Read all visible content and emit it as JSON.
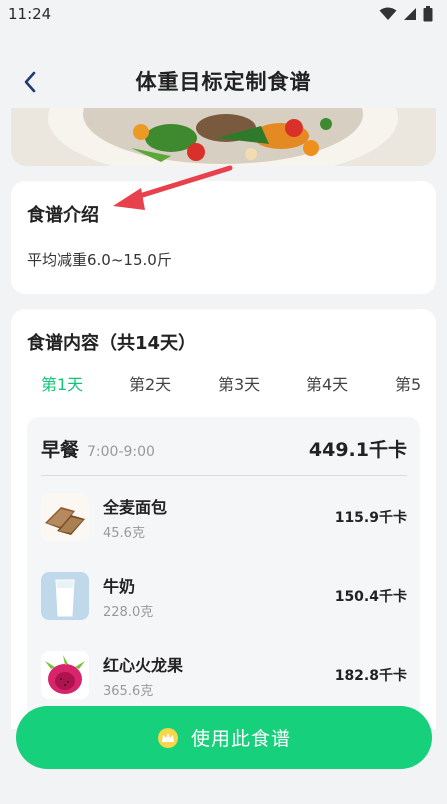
{
  "status_bar": {
    "time": "11:24"
  },
  "header": {
    "title": "体重目标定制食谱",
    "back_icon": "chevron-left-icon"
  },
  "intro": {
    "title": "食谱介绍",
    "description": "平均减重6.0~15.0斤"
  },
  "content": {
    "title": "食谱内容（共14天）",
    "tabs": [
      {
        "label": "第1天",
        "active": true
      },
      {
        "label": "第2天",
        "active": false
      },
      {
        "label": "第3天",
        "active": false
      },
      {
        "label": "第4天",
        "active": false
      },
      {
        "label": "第5",
        "active": false
      }
    ],
    "meal": {
      "name": "早餐",
      "time": "7:00-9:00",
      "kcal": "449.1千卡",
      "foods": [
        {
          "name": "全麦面包",
          "weight": "45.6克",
          "kcal": "115.9千卡",
          "icon": "bread-icon"
        },
        {
          "name": "牛奶",
          "weight": "228.0克",
          "kcal": "150.4千卡",
          "icon": "milk-icon"
        },
        {
          "name": "红心火龙果",
          "weight": "365.6克",
          "kcal": "182.8千卡",
          "icon": "dragon-fruit-icon"
        }
      ]
    }
  },
  "bottom": {
    "button_label": "使用此食谱",
    "button_icon": "crown-icon"
  },
  "colors": {
    "accent": "#17d07c",
    "active_tab": "#12c47a",
    "annotation_arrow": "#e8414d"
  }
}
